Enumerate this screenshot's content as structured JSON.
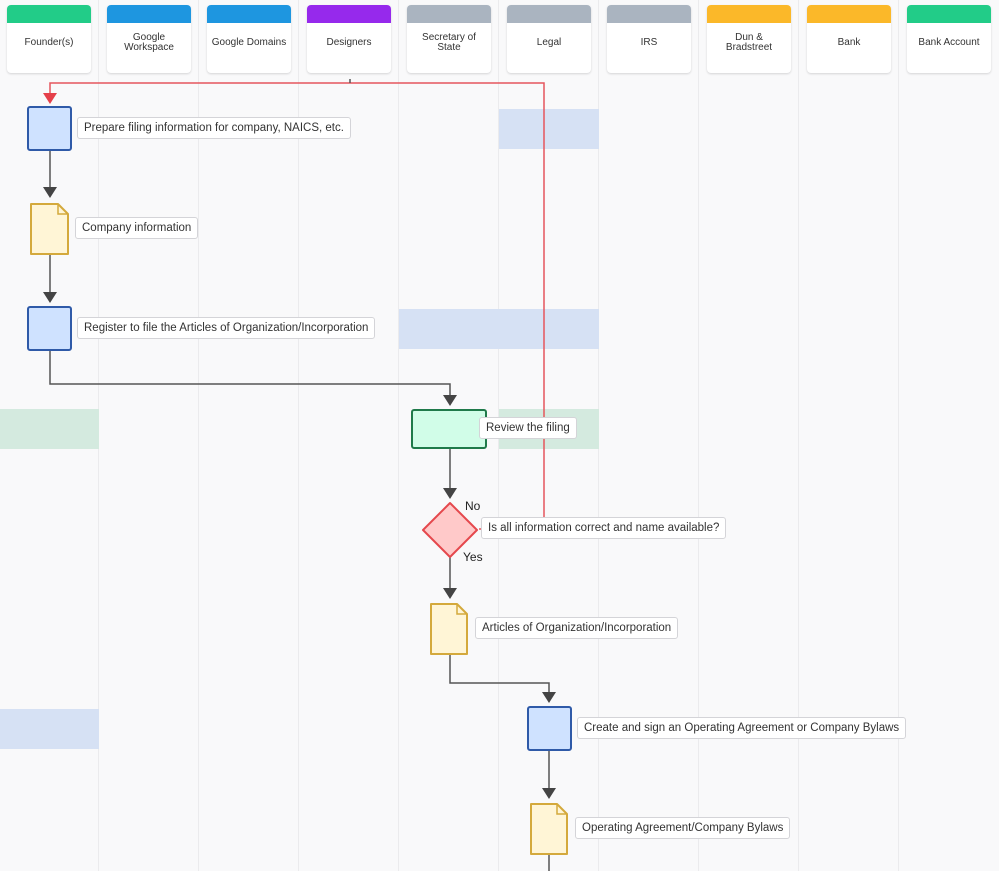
{
  "lanes": [
    {
      "label": "Founder(s)",
      "color": "#22cc88"
    },
    {
      "label": "Google Workspace",
      "color": "#1e96e0"
    },
    {
      "label": "Google Domains",
      "color": "#1e96e0"
    },
    {
      "label": "Designers",
      "color": "#9629ec"
    },
    {
      "label": "Secretary of State",
      "color": "#aab4c0"
    },
    {
      "label": "Legal",
      "color": "#aab4c0"
    },
    {
      "label": "IRS",
      "color": "#aab4c0"
    },
    {
      "label": "Dun & Bradstreet",
      "color": "#fbb829"
    },
    {
      "label": "Bank",
      "color": "#fbb829"
    },
    {
      "label": "Bank Account",
      "color": "#22cc88"
    }
  ],
  "nodes": [
    {
      "id": "prepare",
      "type": "process",
      "label": "Prepare filing information for company, NAICS, etc.",
      "lane": "Founder(s)"
    },
    {
      "id": "company-info",
      "type": "document",
      "label": "Company information",
      "lane": "Founder(s)"
    },
    {
      "id": "register",
      "type": "process",
      "label": "Register to file the Articles of Organization/Incorporation",
      "lane": "Founder(s)"
    },
    {
      "id": "review",
      "type": "process-green",
      "label": "Review the filing",
      "lane": "Secretary of State"
    },
    {
      "id": "decision",
      "type": "decision",
      "label": "Is all information correct and name available?",
      "lane": "Secretary of State"
    },
    {
      "id": "articles",
      "type": "document",
      "label": "Articles of Organization/Incorporation",
      "lane": "Secretary of State"
    },
    {
      "id": "operating",
      "type": "process",
      "label": "Create and sign an Operating Agreement or Company Bylaws",
      "lane": "Legal"
    },
    {
      "id": "bylaws",
      "type": "document",
      "label": "Operating Agreement/Company Bylaws",
      "lane": "Legal"
    }
  ],
  "branches": {
    "no": "No",
    "yes": "Yes"
  },
  "colors": {
    "process_fill": "#cfe2ff",
    "process_stroke": "#2f5aa8",
    "doc_fill": "#fff5d6",
    "doc_stroke": "#d4a93c",
    "green_fill": "#d1fde8",
    "green_stroke": "#1f7a4a",
    "decision_fill": "#ffc9c9",
    "decision_stroke": "#e5484d",
    "edge": "#555555",
    "loop_edge": "#e5484d"
  }
}
